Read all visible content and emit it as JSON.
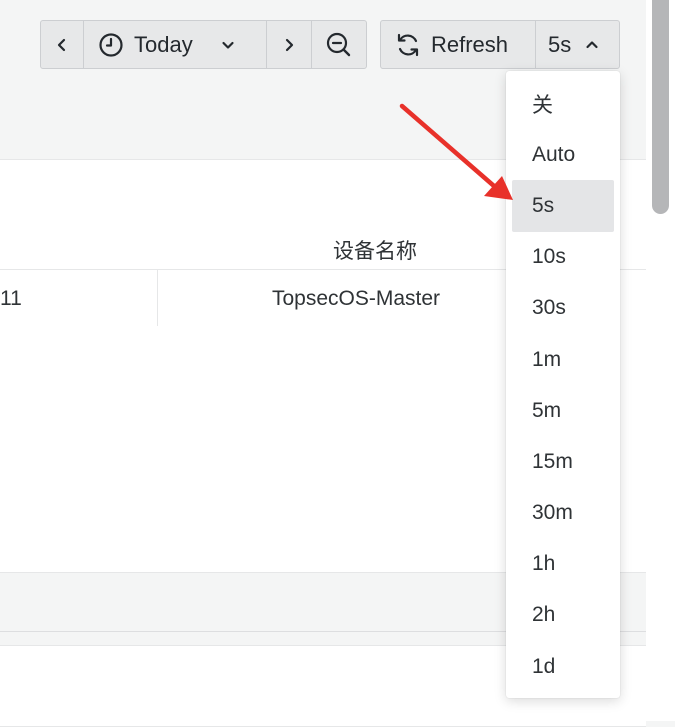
{
  "toolbar": {
    "time_range_label": "Today",
    "refresh_label": "Refresh",
    "interval_value": "5s"
  },
  "table": {
    "column_header": "设备名称",
    "row": {
      "id_partial": "11",
      "device_name": "TopsecOS-Master"
    }
  },
  "refresh_menu": {
    "items": [
      "关",
      "Auto",
      "5s",
      "10s",
      "30s",
      "1m",
      "5m",
      "15m",
      "30m",
      "1h",
      "2h",
      "1d"
    ],
    "selected": "5s"
  },
  "annotation": {
    "arrow_color": "#e8312a"
  }
}
